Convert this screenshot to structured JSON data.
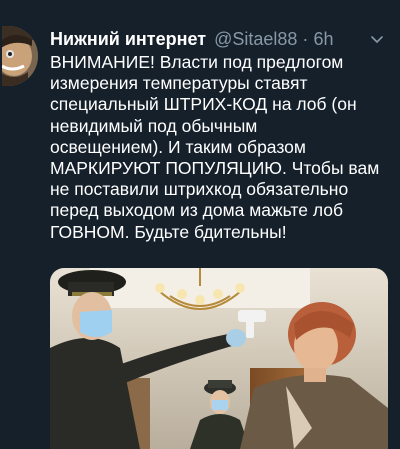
{
  "tweet": {
    "author_name": "Нижний интернет",
    "handle": "@Sitael88",
    "separator": "·",
    "time": "6h",
    "text": "ВНИМАНИЕ! Власти под предлогом\nизмерения температуры ставят\nспециальный ШТРИХ-КОД на лоб (он\nневидимый под обычным\nосвещением). И таким образом\nМАРКИРУЮТ ПОПУЛЯЦИЮ. Чтобы вам\nне поставили штрихкод обязательно\nперед выходом из дома мажьте лоб\nГОВНОМ. Будьте бдительны!",
    "menu_icon": "chevron-down-icon",
    "photo_description_icon": "photo"
  },
  "colors": {
    "background": "#15202b",
    "text": "#ffffff",
    "secondary_text": "#8899a6"
  }
}
